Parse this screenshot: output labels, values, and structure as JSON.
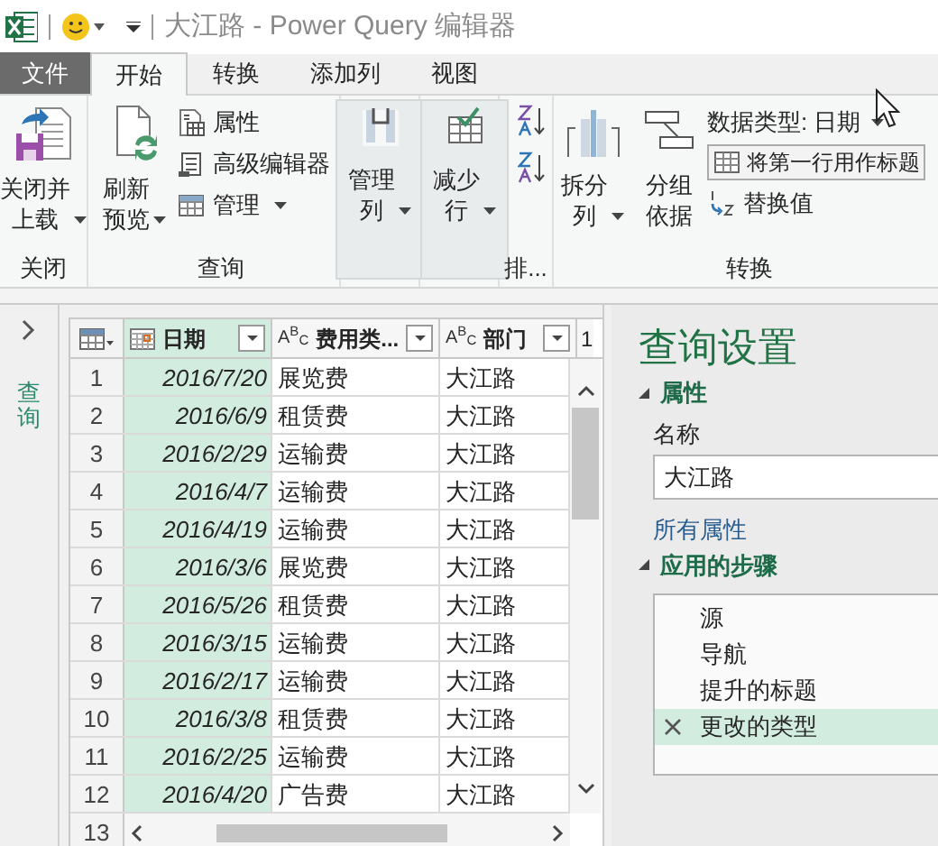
{
  "window": {
    "title": "大江路 - Power Query 编辑器"
  },
  "menu_tabs": [
    {
      "label": "文件",
      "kind": "file"
    },
    {
      "label": "开始",
      "kind": "tab",
      "selected": true
    },
    {
      "label": "转换",
      "kind": "tab",
      "selected": false
    },
    {
      "label": "添加列",
      "kind": "tab",
      "selected": false
    },
    {
      "label": "视图",
      "kind": "tab",
      "selected": false
    }
  ],
  "ribbon": {
    "close": {
      "label": "关闭",
      "button": "关闭并上载"
    },
    "query": {
      "label": "查询",
      "refresh": "刷新预览",
      "properties": "属性",
      "advanced_editor": "高级编辑器",
      "manage": "管理"
    },
    "manage_columns": "管理列",
    "reduce_rows": "减少行",
    "sort": {
      "label": "排..."
    },
    "transform": {
      "label": "转换",
      "split": "拆分列",
      "group_by": "分组依据",
      "data_type": "数据类型: 日期",
      "first_row_header": "将第一行用作标题",
      "replace": "替换值"
    }
  },
  "queries_pane": {
    "label": "查询",
    "expanded": false
  },
  "table": {
    "columns": [
      {
        "label": "日期",
        "kind": "date",
        "selected": true
      },
      {
        "label": "费用类...",
        "kind": "text",
        "type_glyph": "A$^{B}$$_{C}$",
        "selected": false
      },
      {
        "label": "部门",
        "kind": "text",
        "type_glyph": "A$^{B}$$_{C}$",
        "selected": false
      },
      {
        "label": "1",
        "kind": "cut",
        "selected": false
      }
    ],
    "rows": [
      {
        "number": "1",
        "cells": [
          "2016/7/20",
          "展览费",
          "大江路"
        ]
      },
      {
        "number": "2",
        "cells": [
          "2016/6/9",
          "租赁费",
          "大江路"
        ]
      },
      {
        "number": "3",
        "cells": [
          "2016/2/29",
          "运输费",
          "大江路"
        ]
      },
      {
        "number": "4",
        "cells": [
          "2016/4/7",
          "运输费",
          "大江路"
        ]
      },
      {
        "number": "5",
        "cells": [
          "2016/4/19",
          "运输费",
          "大江路"
        ]
      },
      {
        "number": "6",
        "cells": [
          "2016/3/6",
          "展览费",
          "大江路"
        ]
      },
      {
        "number": "7",
        "cells": [
          "2016/5/26",
          "租赁费",
          "大江路"
        ]
      },
      {
        "number": "8",
        "cells": [
          "2016/3/15",
          "运输费",
          "大江路"
        ]
      },
      {
        "number": "9",
        "cells": [
          "2016/2/17",
          "运输费",
          "大江路"
        ]
      },
      {
        "number": "10",
        "cells": [
          "2016/3/8",
          "租赁费",
          "大江路"
        ]
      },
      {
        "number": "11",
        "cells": [
          "2016/2/25",
          "运输费",
          "大江路"
        ]
      },
      {
        "number": "12",
        "cells": [
          "2016/4/20",
          "广告费",
          "大江路"
        ]
      },
      {
        "number": "13",
        "cells": []
      }
    ]
  },
  "query_settings": {
    "title": "查询设置",
    "properties": {
      "label": "属性",
      "expanded": true,
      "name_label": "名称",
      "name_value": "大江路",
      "all_properties_link": "所有属性"
    },
    "applied_steps": {
      "label": "应用的步骤",
      "expanded": true,
      "steps": [
        {
          "label": "源",
          "selected": false
        },
        {
          "label": "导航",
          "selected": false
        },
        {
          "label": "提升的标题",
          "selected": false
        },
        {
          "label": "更改的类型",
          "selected": true
        }
      ]
    }
  }
}
